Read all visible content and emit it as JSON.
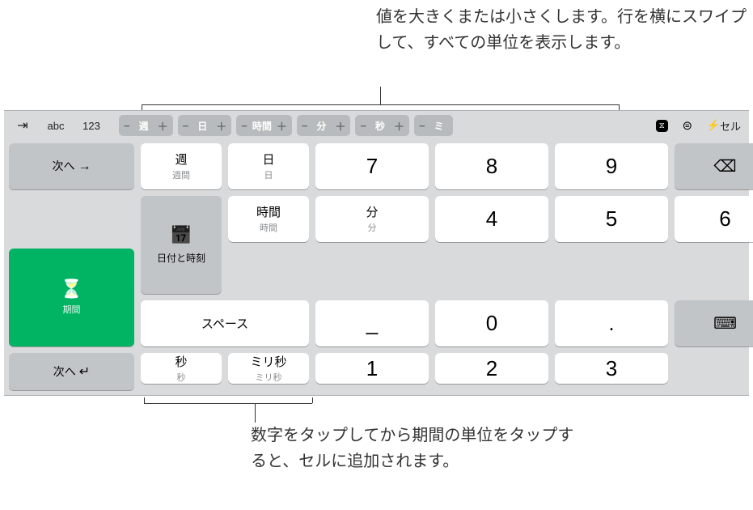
{
  "annotations": {
    "top": "値を大きくまたは小さくします。行を横にスワイプして、すべての単位を表示します。",
    "bottom": "数字をタップしてから期間の単位をタップすると、セルに追加されます。"
  },
  "toolbar": {
    "tab": "⇥",
    "abc": "abc",
    "num": "123",
    "steppers": [
      {
        "label": "週"
      },
      {
        "label": "日"
      },
      {
        "label": "時間"
      },
      {
        "label": "分"
      },
      {
        "label": "秒"
      },
      {
        "label": "ミ"
      }
    ],
    "minus": "−",
    "plus": "＋",
    "equals": "⊜",
    "cell_prefix": "⚡",
    "cell_label": "セル"
  },
  "side": {
    "next": "次へ",
    "next_arrow": "→",
    "datetime": "日付と時刻",
    "duration": "期間",
    "next_return": "次へ",
    "return_arrow": "↵"
  },
  "units": {
    "week": {
      "main": "週",
      "sub": "週間"
    },
    "day": {
      "main": "日",
      "sub": "日"
    },
    "hour": {
      "main": "時間",
      "sub": "時間"
    },
    "minute": {
      "main": "分",
      "sub": "分"
    },
    "second": {
      "main": "秒",
      "sub": "秒"
    },
    "ms": {
      "main": "ミリ秒",
      "sub": "ミリ秒"
    }
  },
  "numbers": {
    "7": "7",
    "8": "8",
    "9": "9",
    "4": "4",
    "5": "5",
    "6": "6",
    "1": "1",
    "2": "2",
    "3": "3",
    "0": "0",
    "hyphen": "_",
    "dot": "."
  },
  "space": "スペース",
  "icons": {
    "backspace": "⌫",
    "calendar": "📅",
    "hourglass": "⏳",
    "keyboard": "⌨",
    "duration_badge": "⧖"
  }
}
